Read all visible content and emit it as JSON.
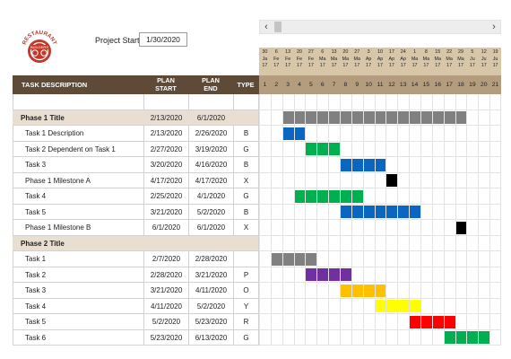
{
  "logo": {
    "arc_text": "RESTAURANT",
    "inner_text": "BUILDERS",
    "color": "#c0392b"
  },
  "project_start": {
    "label": "Project Start:",
    "value": "1/30/2020"
  },
  "scrollbar": {
    "left_icon": "‹",
    "right_icon": "›"
  },
  "date_header": [
    [
      "30",
      "Ja",
      "17"
    ],
    [
      "6",
      "Fe",
      "17"
    ],
    [
      "13",
      "Fe",
      "17"
    ],
    [
      "20",
      "Fe",
      "17"
    ],
    [
      "27",
      "Fe",
      "17"
    ],
    [
      "6",
      "Ma",
      "17"
    ],
    [
      "13",
      "Ma",
      "17"
    ],
    [
      "20",
      "Ma",
      "17"
    ],
    [
      "27",
      "Ma",
      "17"
    ],
    [
      "3",
      "Ap",
      "17"
    ],
    [
      "10",
      "Ap",
      "17"
    ],
    [
      "17",
      "Ap",
      "17"
    ],
    [
      "24",
      "Ap",
      "17"
    ],
    [
      "1",
      "Ma",
      "17"
    ],
    [
      "8",
      "Ma",
      "17"
    ],
    [
      "15",
      "Ma",
      "17"
    ],
    [
      "22",
      "Ma",
      "17"
    ],
    [
      "29",
      "Ma",
      "17"
    ],
    [
      "5",
      "Ju",
      "17"
    ],
    [
      "12",
      "Ju",
      "17"
    ],
    [
      "19",
      "Ju",
      "17"
    ]
  ],
  "week_numbers": [
    "1",
    "2",
    "3",
    "4",
    "5",
    "6",
    "7",
    "8",
    "9",
    "10",
    "11",
    "12",
    "13",
    "14",
    "15",
    "16",
    "17",
    "18",
    "19",
    "20",
    "21"
  ],
  "columns": {
    "desc": "TASK DESCRIPTION",
    "start_1": "PLAN",
    "start_2": "START",
    "end_1": "PLAN",
    "end_2": "END",
    "type": "TYPE"
  },
  "colors": {
    "header_dark": "#5e4a36",
    "header_tan": "#b49d7f",
    "date_tan": "#d8c6a8",
    "phase_bg": "#e8dfd2"
  },
  "rows": [
    {
      "kind": "spacer"
    },
    {
      "kind": "phase",
      "desc": "Phase 1 Title",
      "start": "2/13/2020",
      "end": "6/1/2020",
      "type": "",
      "bar_start_week": 3,
      "bar_weeks": 16,
      "color": "#808080"
    },
    {
      "kind": "task",
      "desc": "Task 1 Description",
      "start": "2/13/2020",
      "end": "2/26/2020",
      "type": "B",
      "bar_start_week": 3,
      "bar_weeks": 2,
      "color": "#0b66c2"
    },
    {
      "kind": "task",
      "desc": "Task 2 Dependent on Task 1",
      "start": "2/27/2020",
      "end": "3/19/2020",
      "type": "G",
      "bar_start_week": 5,
      "bar_weeks": 3,
      "color": "#00b050"
    },
    {
      "kind": "task",
      "desc": "Task 3",
      "start": "3/20/2020",
      "end": "4/16/2020",
      "type": "B",
      "bar_start_week": 8,
      "bar_weeks": 4,
      "color": "#0b66c2"
    },
    {
      "kind": "task",
      "desc": "Phase 1 Milestone A",
      "start": "4/17/2020",
      "end": "4/17/2020",
      "type": "X",
      "bar_start_week": 12,
      "bar_weeks": 1,
      "color": "#000000"
    },
    {
      "kind": "task",
      "desc": "Task 4",
      "start": "2/25/2020",
      "end": "4/1/2020",
      "type": "G",
      "bar_start_week": 4,
      "bar_weeks": 6,
      "color": "#00b050"
    },
    {
      "kind": "task",
      "desc": "Task 5",
      "start": "3/21/2020",
      "end": "5/2/2020",
      "type": "B",
      "bar_start_week": 8,
      "bar_weeks": 7,
      "color": "#0b66c2"
    },
    {
      "kind": "task",
      "desc": "Phase 1 Milestone B",
      "start": "6/1/2020",
      "end": "6/1/2020",
      "type": "X",
      "bar_start_week": 18,
      "bar_weeks": 1,
      "color": "#000000"
    },
    {
      "kind": "phase",
      "desc": "Phase 2 Title",
      "start": "",
      "end": "",
      "type": ""
    },
    {
      "kind": "task",
      "desc": "Task 1",
      "start": "2/7/2020",
      "end": "2/28/2020",
      "type": "",
      "bar_start_week": 2,
      "bar_weeks": 4,
      "color": "#808080"
    },
    {
      "kind": "task",
      "desc": "Task 2",
      "start": "2/28/2020",
      "end": "3/21/2020",
      "type": "P",
      "bar_start_week": 5,
      "bar_weeks": 4,
      "color": "#7030a0"
    },
    {
      "kind": "task",
      "desc": "Task 3",
      "start": "3/21/2020",
      "end": "4/11/2020",
      "type": "O",
      "bar_start_week": 8,
      "bar_weeks": 4,
      "color": "#ffc000"
    },
    {
      "kind": "task",
      "desc": "Task 4",
      "start": "4/11/2020",
      "end": "5/2/2020",
      "type": "Y",
      "bar_start_week": 11,
      "bar_weeks": 4,
      "color": "#ffff00"
    },
    {
      "kind": "task",
      "desc": "Task 5",
      "start": "5/2/2020",
      "end": "5/23/2020",
      "type": "R",
      "bar_start_week": 14,
      "bar_weeks": 4,
      "color": "#ff0000"
    },
    {
      "kind": "task",
      "desc": "Task 6",
      "start": "5/23/2020",
      "end": "6/13/2020",
      "type": "G",
      "bar_start_week": 17,
      "bar_weeks": 4,
      "color": "#00b050"
    }
  ]
}
